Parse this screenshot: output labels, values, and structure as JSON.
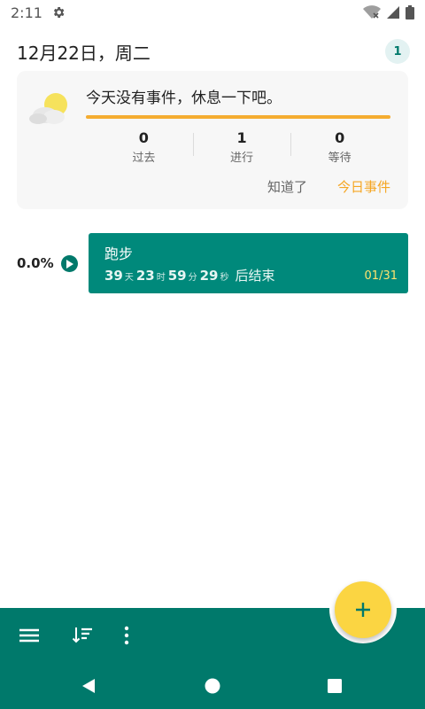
{
  "status_bar": {
    "time": "2:11",
    "icons": [
      "gear-icon",
      "wifi-off-icon",
      "signal-icon",
      "battery-icon"
    ]
  },
  "header": {
    "date": "12月22日，周二",
    "badge": "1"
  },
  "summary": {
    "message": "今天没有事件，休息一下吧。",
    "icon": "weather-partly-cloudy-icon",
    "stats": [
      {
        "value": "0",
        "label": "过去"
      },
      {
        "value": "1",
        "label": "进行"
      },
      {
        "value": "0",
        "label": "等待"
      }
    ],
    "actions": {
      "got_it": "知道了",
      "today_events": "今日事件"
    },
    "colors": {
      "accent": "#f5ad31"
    }
  },
  "event": {
    "percent": "0.0%",
    "title": "跑步",
    "countdown": {
      "days": "39",
      "days_unit": "天",
      "hours": "23",
      "hours_unit": "时",
      "minutes": "59",
      "minutes_unit": "分",
      "seconds": "29",
      "seconds_unit": "秒",
      "suffix": "后结束"
    },
    "counter": "01/31",
    "colors": {
      "card": "#00897b"
    }
  },
  "bottom_bar": {
    "icons": [
      "menu-icon",
      "sort-icon",
      "more-vert-icon",
      "add-icon"
    ],
    "colors": {
      "bar": "#00796b",
      "fab": "#fbd542"
    }
  },
  "nav_bar": {
    "icons": [
      "back-icon",
      "home-icon",
      "recents-icon"
    ]
  }
}
